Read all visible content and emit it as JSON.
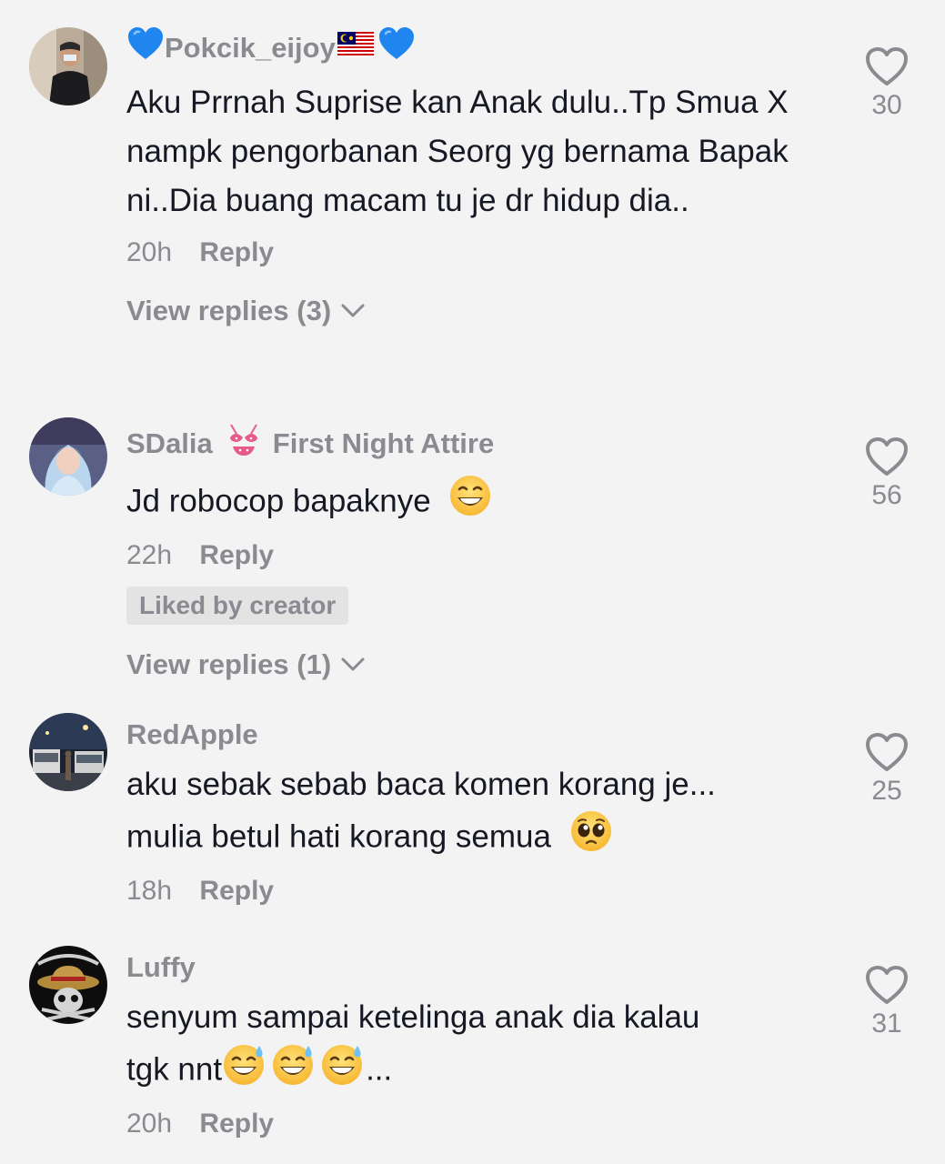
{
  "comments": [
    {
      "username": "Pokcik_eijoy",
      "username_prefix_icon": "blue-heart-icon",
      "username_suffix_icons": [
        "malaysia-flag-icon",
        "blue-heart-icon"
      ],
      "text": "Aku Prrnah Suprise kan Anak dulu..Tp Smua X nampk pengorbanan Seorg yg bernama Bapak ni..Dia buang macam tu je dr hidup dia..",
      "time": "20h",
      "reply_label": "Reply",
      "view_replies": "View replies (3)",
      "likes": "30"
    },
    {
      "username": "SDalia",
      "username_icon": "bikini-icon",
      "username_suffix": "First Night Attire",
      "text": "Jd robocop bapaknye",
      "text_emoji": "grinning-face-icon",
      "time": "22h",
      "reply_label": "Reply",
      "badge": "Liked by creator",
      "view_replies": "View replies (1)",
      "likes": "56"
    },
    {
      "username": "RedApple",
      "text_line1": "aku sebak sebab baca komen korang je...",
      "text_line2": "mulia betul hati korang semua",
      "text_emoji": "pleading-face-icon",
      "time": "18h",
      "reply_label": "Reply",
      "likes": "25"
    },
    {
      "username": "Luffy",
      "text_line1": "senyum sampai ketelinga anak dia kalau",
      "text_line2": "tgk nnt",
      "text_emojis": [
        "sweat-smile-icon",
        "sweat-smile-icon",
        "sweat-smile-icon"
      ],
      "text_suffix": "...",
      "time": "20h",
      "reply_label": "Reply",
      "likes": "31"
    }
  ],
  "colors": {
    "background": "#f3f3f3",
    "text": "#161823",
    "muted": "#8a8b91",
    "badge_bg": "#e3e3e4"
  }
}
